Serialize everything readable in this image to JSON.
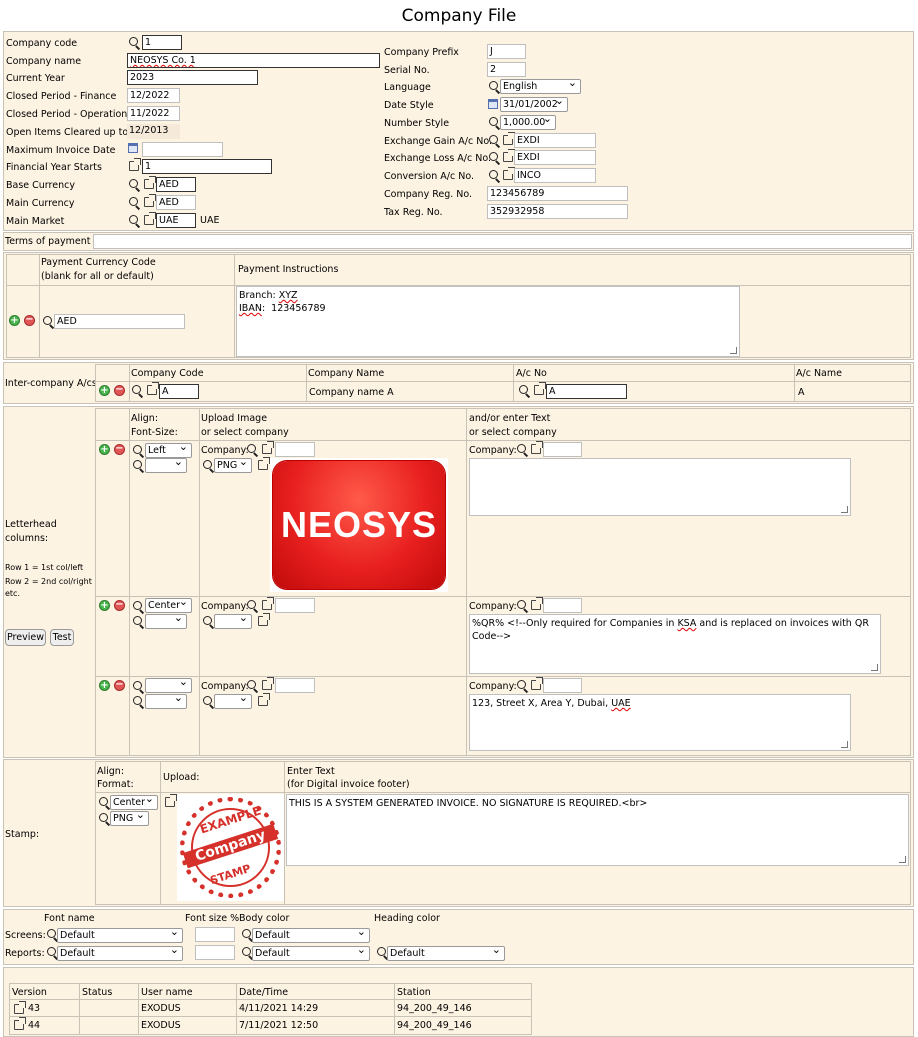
{
  "title": "Company File",
  "left_fields": [
    {
      "label": "Company code",
      "value": "1"
    },
    {
      "label": "Company name",
      "value": "NEOSYS Co. 1"
    },
    {
      "label": "Current Year",
      "value": "2023"
    },
    {
      "label": "Closed Period - Finance",
      "value": "12/2022"
    },
    {
      "label": "Closed Period - Operations",
      "value": "11/2022"
    },
    {
      "label": "Open Items Cleared up to",
      "value": "12/2013"
    },
    {
      "label": "Maximum Invoice Date",
      "value": ""
    },
    {
      "label": "Financial Year Starts",
      "value": "1"
    },
    {
      "label": "Base Currency",
      "value": "AED"
    },
    {
      "label": "Main Currency",
      "value": "AED"
    },
    {
      "label": "Main Market",
      "value": "UAE",
      "extra": "UAE"
    }
  ],
  "right_fields": [
    {
      "label": "Company Prefix",
      "value": "J"
    },
    {
      "label": "Serial No.",
      "value": "2"
    },
    {
      "label": "Language",
      "value": "English"
    },
    {
      "label": "Date Style",
      "value": "31/01/2002"
    },
    {
      "label": "Number Style",
      "value": "1,000.00"
    },
    {
      "label": "Exchange Gain A/c No.",
      "value": "EXDI"
    },
    {
      "label": "Exchange Loss A/c No.",
      "value": "EXDI"
    },
    {
      "label": "Conversion A/c No.",
      "value": "INCO"
    },
    {
      "label": "Company Reg. No.",
      "value": "123456789"
    },
    {
      "label": "Tax Reg. No.",
      "value": "352932958"
    }
  ],
  "terms": {
    "label": "Terms of payment",
    "value": ""
  },
  "payment": {
    "col1_line1": "Payment Currency Code",
    "col1_line2": "(blank for all or default)",
    "col2": "Payment Instructions",
    "currency": "AED",
    "instr_branch_label": "Branch: ",
    "instr_branch_value": "XYZ",
    "instr_iban_label": "IBAN",
    "instr_iban_value": ":  123456789"
  },
  "intercompany": {
    "label": "Inter-company A/cs",
    "headers": [
      "Company Code",
      "Company Name",
      "A/c No",
      "A/c Name"
    ],
    "row": {
      "code": "A",
      "name": "Company name A",
      "acno": "A",
      "acname": "A"
    }
  },
  "letterhead": {
    "label_line1": "Letterhead",
    "label_line2": "columns:",
    "note1": "Row 1 = 1st col/left",
    "note2": "Row 2 = 2nd col/right",
    "note3": "etc.",
    "preview": "Preview",
    "test": "Test",
    "h_align1": "Align:",
    "h_align2": "Font-Size:",
    "h_upload1": "Upload Image",
    "h_upload2": "or select company",
    "h_text1": "and/or enter Text",
    "h_text2": "or select company",
    "company_label": "Company:",
    "logo_text": "NEOSYS",
    "rows": [
      {
        "align": "Left",
        "format": "PNG",
        "text": ""
      },
      {
        "align": "Center",
        "format": "",
        "text_pre": "%QR% <!--Only required for Companies in ",
        "text_ksa": "KSA",
        "text_post": " and is replaced on invoices with QR Code-->"
      },
      {
        "align": "",
        "format": "",
        "text_pre": "123, Street X, Area Y, Dubai, ",
        "text_uae": "UAE"
      }
    ]
  },
  "stamp": {
    "label": "Stamp:",
    "h_align1": "Align:",
    "h_align2": "Format:",
    "h_upload": "Upload:",
    "h_text1": "Enter Text",
    "h_text2": "(for Digital invoice footer)",
    "align": "Center",
    "format": "PNG",
    "text": "THIS IS A SYSTEM GENERATED INVOICE. NO SIGNATURE IS REQUIRED.<br>",
    "stamp_top": "EXAMPLE",
    "stamp_mid": "Company",
    "stamp_bottom": "STAMP"
  },
  "fonts": {
    "h_font": "Font name",
    "h_size": "Font size %",
    "h_body": "Body color",
    "h_heading": "Heading color",
    "screens_label": "Screens:",
    "reports_label": "Reports:",
    "screens_font": "Default",
    "screens_body": "Default",
    "reports_font": "Default",
    "reports_body": "Default",
    "reports_heading": "Default"
  },
  "versions": {
    "headers": [
      "Version",
      "Status",
      "User name",
      "Date/Time",
      "Station"
    ],
    "rows": [
      {
        "version": "43",
        "status": "",
        "user": "EXODUS",
        "datetime": "4/11/2021 14:29",
        "station": "94_200_49_146"
      },
      {
        "version": "44",
        "status": "",
        "user": "EXODUS",
        "datetime": "7/11/2021 12:50",
        "station": "94_200_49_146"
      }
    ]
  },
  "colors": {
    "panel_bg": "#fdf3e3",
    "border": "#c9c2b6",
    "logo_red": "#e8201f"
  }
}
